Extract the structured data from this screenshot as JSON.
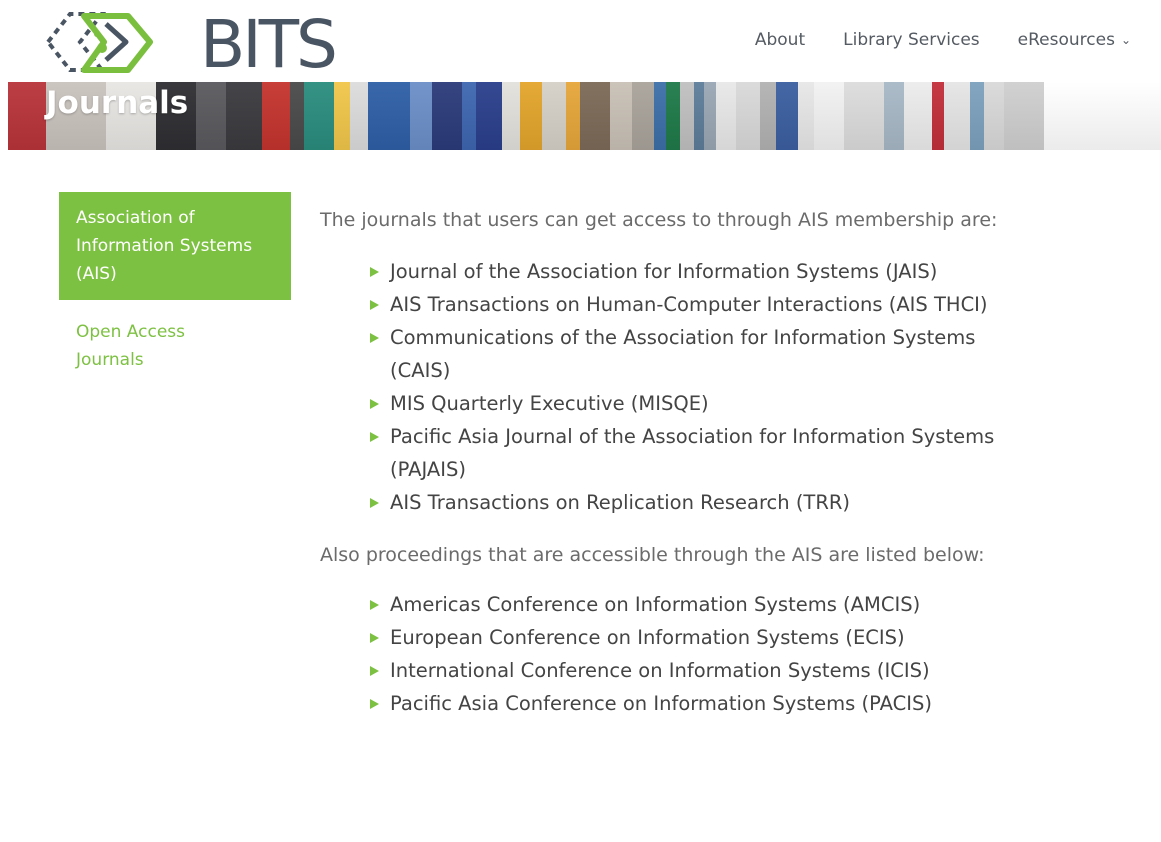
{
  "header": {
    "logo_text": "BITS",
    "nav": [
      {
        "label": "About"
      },
      {
        "label": "Library Services"
      },
      {
        "label": "eResources",
        "has_dropdown": true
      }
    ]
  },
  "banner": {
    "title": "Journals"
  },
  "sidebar": {
    "items": [
      {
        "label": "Association of Information Systems (AIS)",
        "active": true
      },
      {
        "label": "Open Access Journals",
        "active": false
      }
    ]
  },
  "main": {
    "intro": "The journals that users can get access to through AIS membership are:",
    "journals": [
      "Journal of the Association for Information Systems (JAIS)",
      "AIS Transactions on Human-Computer Interactions (AIS THCI)",
      "Communications of the Association for Information Systems (CAIS)",
      "MIS Quarterly Executive (MISQE)",
      "Pacific Asia Journal of the Association for Information Systems (PAJAIS)",
      "AIS Transactions on Replication Research (TRR)"
    ],
    "proceedings_intro": "Also proceedings that are accessible through the AIS are listed below:",
    "proceedings": [
      "Americas Conference on Information Systems (AMCIS)",
      "European Conference on Information Systems (ECIS)",
      "International Conference on Information Systems (ICIS)",
      "Pacific Asia Conference on Information Systems (PACIS)"
    ]
  },
  "colors": {
    "accent": "#7dc142",
    "logo_text": "#4a5563"
  },
  "icons": [
    "bits-logo-icon",
    "chevron-down-icon",
    "triangle-bullet-icon"
  ]
}
